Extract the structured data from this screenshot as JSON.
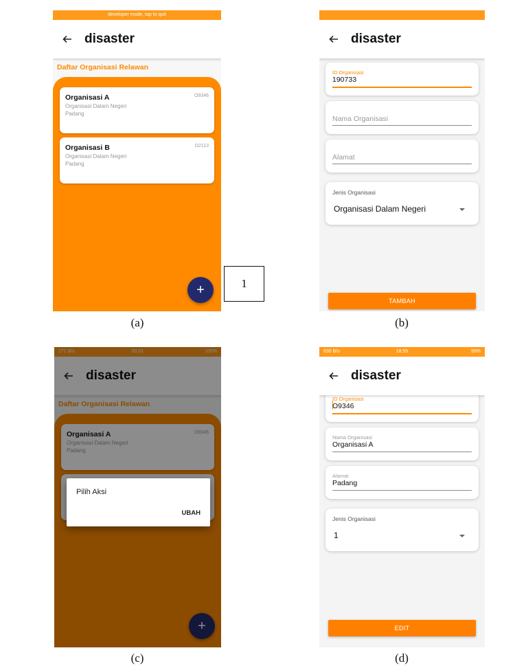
{
  "app_title": "disaster",
  "screens": {
    "a": {
      "caption": "(a)",
      "statusbar_text": "developer mode, tap to quit",
      "section_title": "Daftar Organisasi Relawan",
      "organizations": [
        {
          "name": "Organisasi A",
          "type": "Organisasi Dalam Negeri",
          "address": "Padang",
          "code": "O9346"
        },
        {
          "name": "Organisasi B",
          "type": "Organisasi Dalam Negeri",
          "address": "Padang",
          "code": "O2113"
        }
      ],
      "fab_icon": "plus-icon",
      "fab_glyph": "+",
      "callout_label": "1"
    },
    "b": {
      "caption": "(b)",
      "fields": {
        "id_label": "ID Organisasi",
        "id_value": "190733",
        "name_placeholder": "Nama Organisasi",
        "address_placeholder": "Alamat",
        "type_label": "Jenis Organisasi",
        "type_value": "Organisasi Dalam Negeri"
      },
      "button_label": "TAMBAH"
    },
    "c": {
      "caption": "(c)",
      "statusbar_left": "171 B/s",
      "statusbar_time": "00:01",
      "statusbar_right": "100%",
      "dialog_title": "Pilih Aksi",
      "dialog_action": "UBAH"
    },
    "d": {
      "caption": "(d)",
      "statusbar_left": "630 B/s",
      "statusbar_time": "18:55",
      "statusbar_right": "99%",
      "fields": {
        "id_label": "ID Organisasi",
        "id_value": "O9346",
        "name_label": "Nama Organisasi",
        "name_value": "Organisasi A",
        "address_label": "Alamat",
        "address_value": "Padang",
        "type_label": "Jenis Organisasi",
        "type_value": "1"
      },
      "button_label": "EDIT"
    }
  },
  "colors": {
    "primary_orange": "#ff8a00",
    "statusbar_orange": "#ff9a1a",
    "fab_navy": "#232a6b",
    "form_background": "#f4f4f4"
  }
}
